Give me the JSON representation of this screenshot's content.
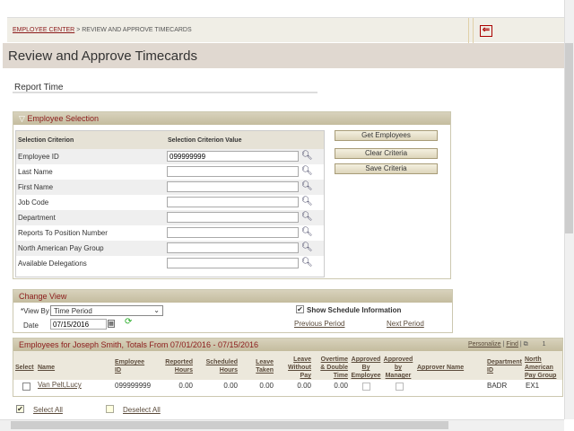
{
  "breadcrumb": {
    "home": "EMPLOYEE CENTER",
    "separator": ">",
    "current": "REVIEW AND APPROVE TIMECARDS"
  },
  "page_title": "Review and Approve Timecards",
  "section_title": "Report Time",
  "employee_selection": {
    "title": "Employee Selection",
    "headers": [
      "Selection Criterion",
      "Selection Criterion Value"
    ],
    "rows": [
      {
        "label": "Employee ID",
        "value": "099999999"
      },
      {
        "label": "Last Name",
        "value": ""
      },
      {
        "label": "First Name",
        "value": ""
      },
      {
        "label": "Job Code",
        "value": ""
      },
      {
        "label": "Department",
        "value": ""
      },
      {
        "label": "Reports To Position Number",
        "value": ""
      },
      {
        "label": "North American Pay Group",
        "value": ""
      },
      {
        "label": "Available Delegations",
        "value": ""
      }
    ],
    "buttons": [
      "Get Employees",
      "Clear Criteria",
      "Save Criteria"
    ]
  },
  "change_view": {
    "title": "Change View",
    "view_by_label": "*View By",
    "view_by_value": "Time Period",
    "date_label": "Date",
    "date_value": "07/15/2016",
    "show_schedule_label": "Show Schedule Information",
    "show_schedule_checked": true,
    "previous": "Previous Period",
    "next": "Next Period"
  },
  "grid": {
    "title": "Employees for Joseph Smith, Totals From 07/01/2016 - 07/15/2016",
    "personalize": "Personalize",
    "find": "Find",
    "pipe": "|",
    "page": "1",
    "columns": {
      "select": "Select",
      "name": "Name",
      "emp1": "Employee",
      "emp2": "ID",
      "rep1": "Reported",
      "rep2": "Hours",
      "sch1": "Scheduled",
      "sch2": "Hours",
      "lt1": "Leave",
      "lt2": "Taken",
      "lwp1": "Leave",
      "lwp2": "Without",
      "lwp3": "Pay",
      "ot1": "Overtime",
      "ot2": "& Double",
      "ot3": "Time",
      "abe1": "Approved",
      "abe2": "By",
      "abe3": "Employee",
      "abm1": "Approved",
      "abm2": "by",
      "abm3": "Manager",
      "approver": "Approver Name",
      "dep1": "Department",
      "dep2": "ID",
      "na1": "North",
      "na2": "American",
      "na3": "Pay Group"
    },
    "rows": [
      {
        "name": "Van Pelt,Lucy",
        "employee_id": "099999999",
        "reported": "0.00",
        "scheduled": "0.00",
        "leave_taken": "0.00",
        "leave_without_pay": "0.00",
        "overtime": "0.00",
        "approver": "",
        "department": "BADR",
        "pay_group": "EX1"
      }
    ]
  },
  "select_all": "Select All",
  "deselect_all": "Deselect All"
}
